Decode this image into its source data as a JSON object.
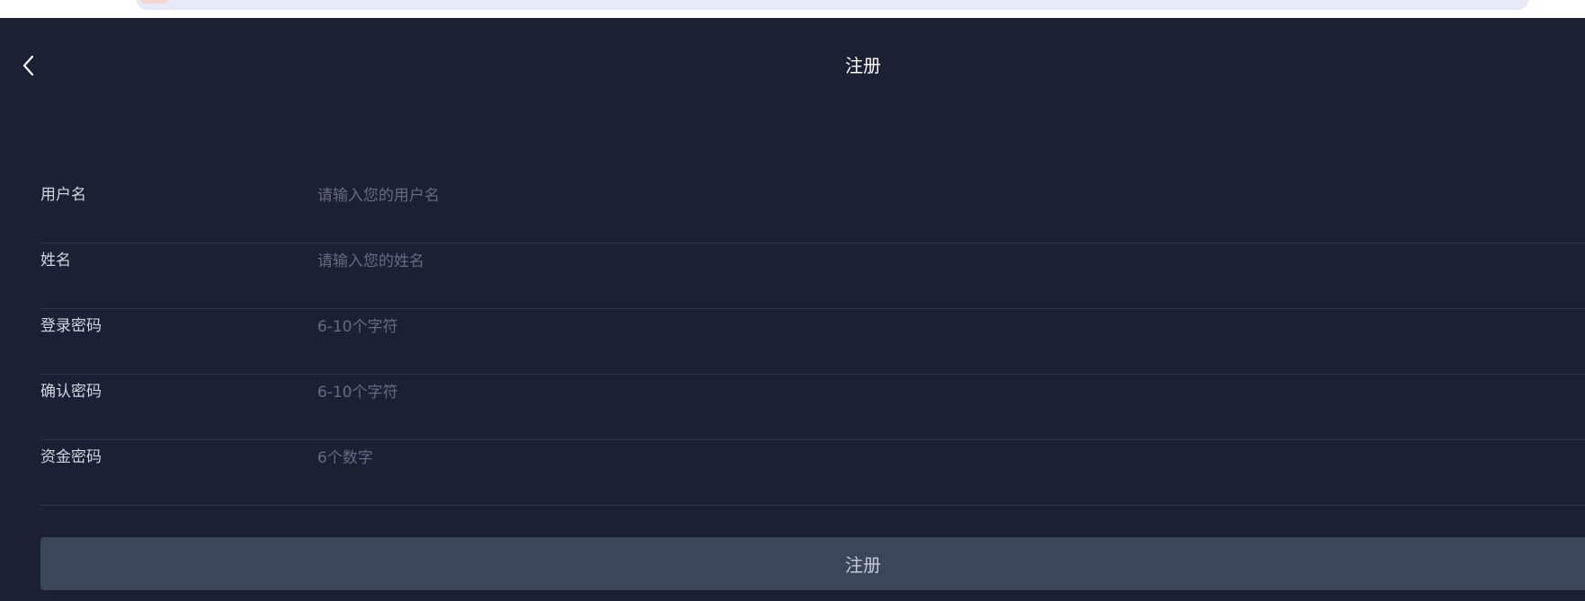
{
  "header": {
    "title": "注册",
    "back_icon": "chevron-left-icon"
  },
  "form": {
    "fields": [
      {
        "label": "用户名",
        "placeholder": "请输入您的用户名",
        "value": ""
      },
      {
        "label": "姓名",
        "placeholder": "请输入您的姓名",
        "value": ""
      },
      {
        "label": "登录密码",
        "placeholder": "6-10个字符",
        "value": ""
      },
      {
        "label": "确认密码",
        "placeholder": "6-10个字符",
        "value": ""
      },
      {
        "label": "资金密码",
        "placeholder": "6个数字",
        "value": ""
      }
    ],
    "submit_label": "注册"
  },
  "colors": {
    "background": "#1b2033",
    "button": "#3a475b",
    "divider": "#2f3548",
    "placeholder": "#646b83",
    "label": "#d2d6e1"
  }
}
